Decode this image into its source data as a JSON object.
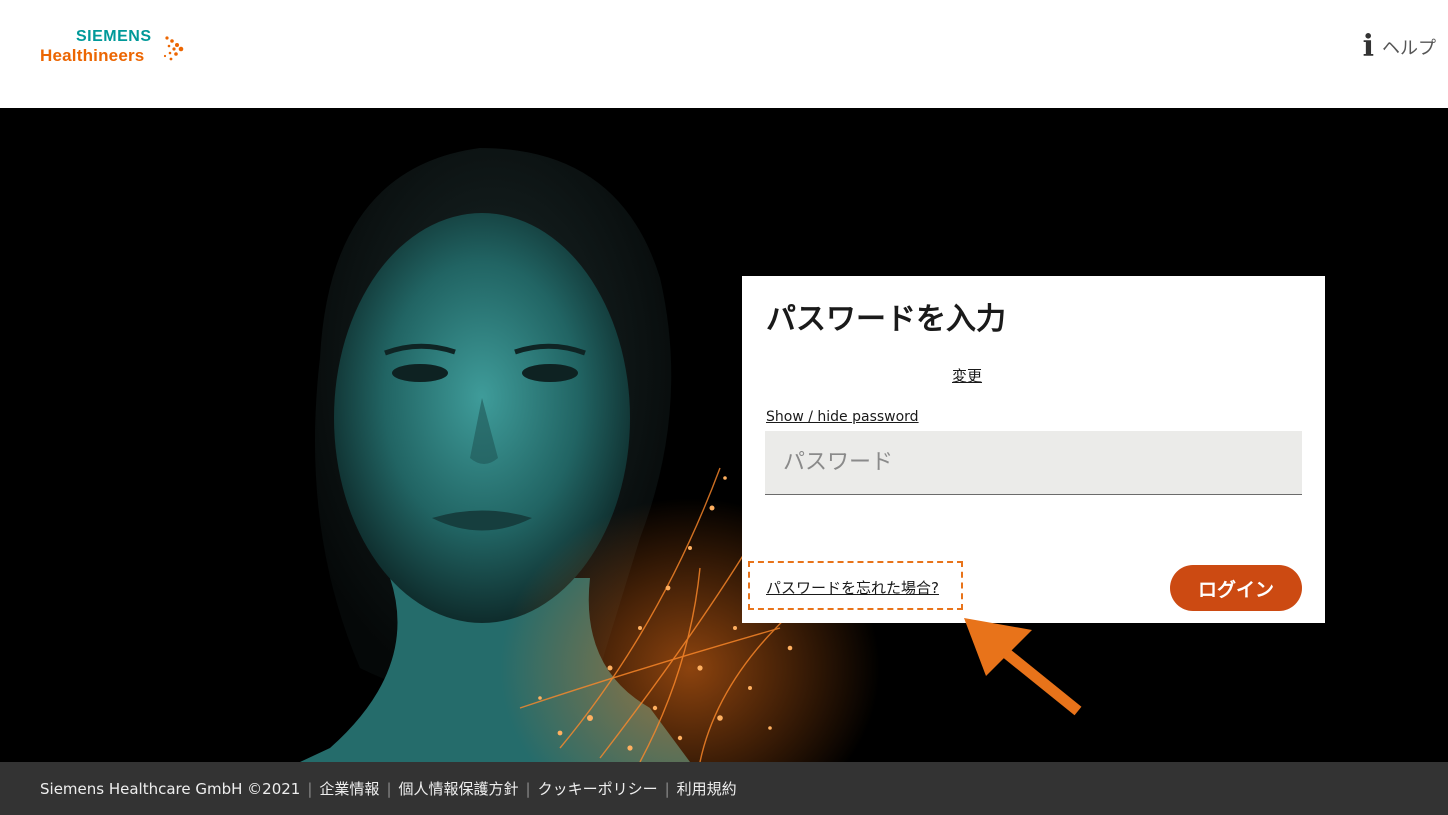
{
  "header": {
    "logo_top": "SIEMENS",
    "logo_bottom": "Healthineers",
    "help_label": "ヘルプ"
  },
  "login": {
    "title": "パスワードを入力",
    "change_link": "変更",
    "show_hide": "Show / hide password",
    "password_placeholder": "パスワード",
    "forgot_link": "パスワードを忘れた場合?",
    "login_button": "ログイン"
  },
  "footer": {
    "copyright": "Siemens Healthcare GmbH ©2021",
    "links": [
      "企業情報",
      "個人情報保護方針",
      "クッキーポリシー",
      "利用規約"
    ]
  },
  "colors": {
    "brand_teal": "#009999",
    "brand_orange": "#ec6602",
    "button": "#cc4a12",
    "annotation": "#e8731a",
    "footer_bg": "#333333"
  }
}
